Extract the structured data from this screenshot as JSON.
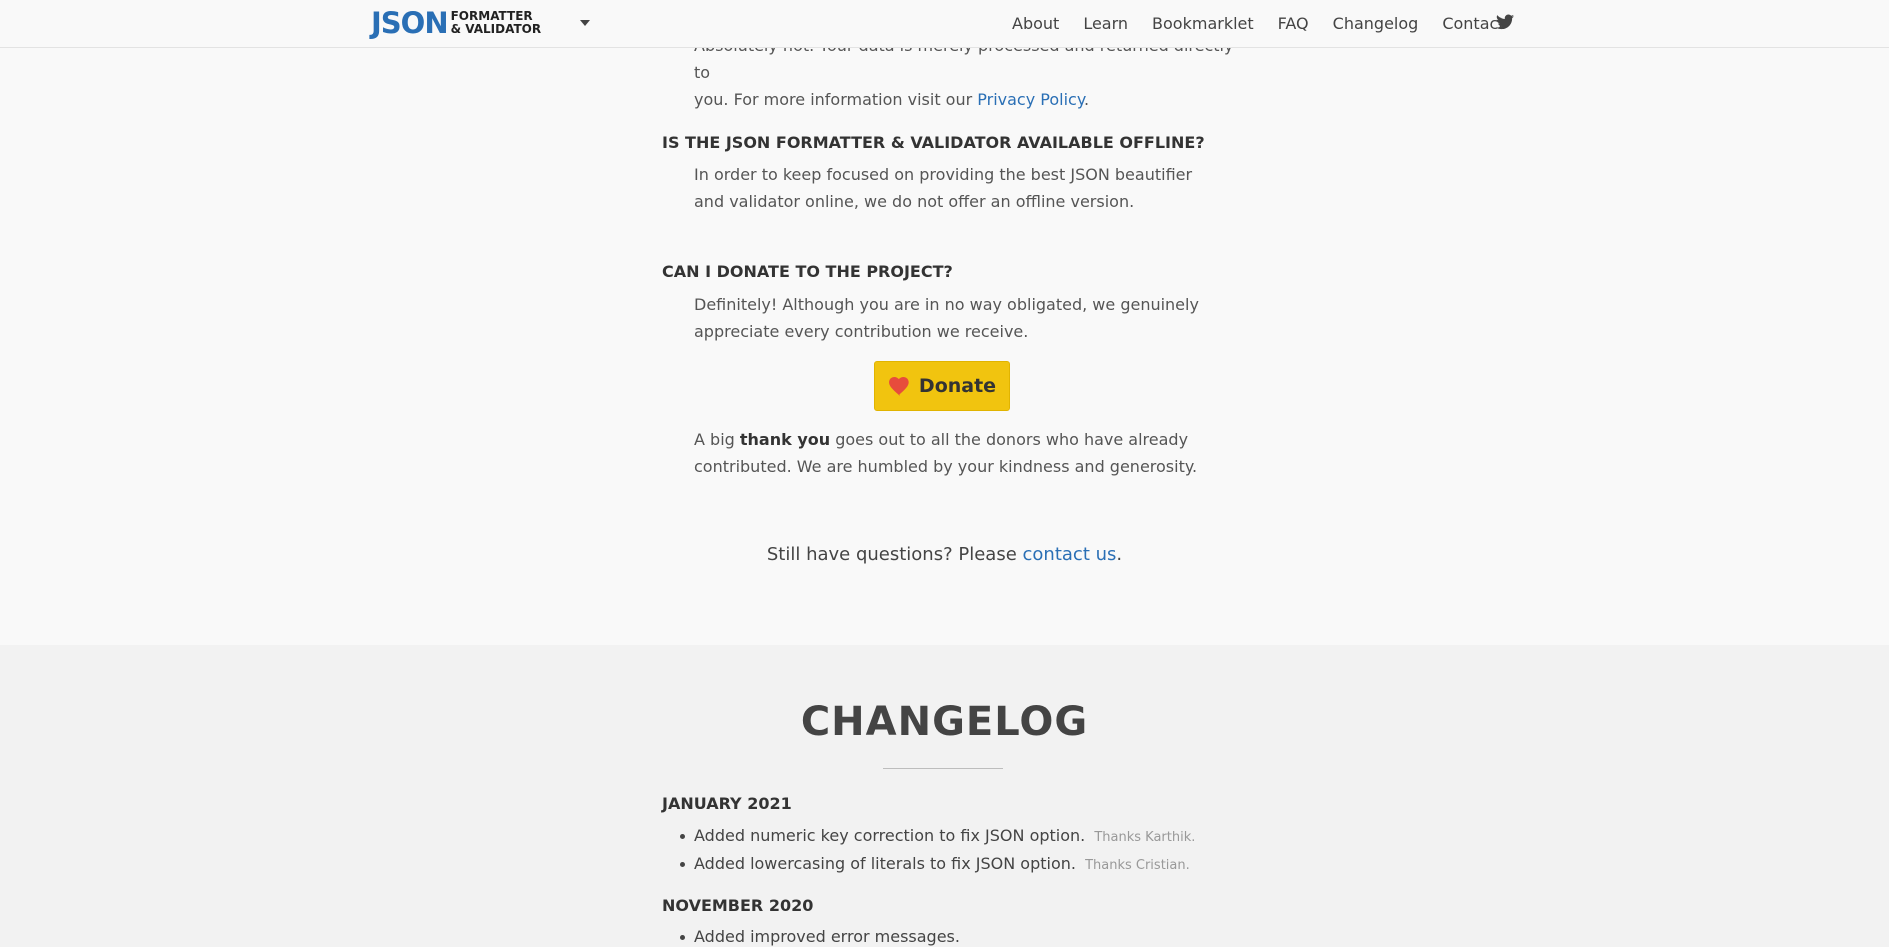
{
  "nav": {
    "logo_main": "JSON",
    "logo_line1": "FORMATTER",
    "logo_line2": "& VALIDATOR",
    "links": [
      "About",
      "Learn",
      "Bookmarklet",
      "FAQ",
      "Changelog",
      "Contact"
    ],
    "twitter_icon": "twitter-icon"
  },
  "faq": {
    "partial_answer_line1": "Absolutely not. Your data is merely processed and returned directly to",
    "partial_answer_line2_prefix": "you. For more information visit our ",
    "privacy_link": "Privacy Policy",
    "partial_answer_line2_suffix": ".",
    "offline_question": "Is the JSON Formatter & Validator available offline?",
    "offline_answer": "In order to keep focused on providing the best JSON beautifier and validator online, we do not offer an offline version.",
    "donate_question": "Can I donate to the project?",
    "donate_answer": "Definitely! Although you are in no way obligated, we genuinely appreciate every contribution we receive.",
    "donate_button": "Donate",
    "thanks_prefix": "A big ",
    "thanks_bold": "thank you",
    "thanks_suffix": " goes out to all the donors who have already contributed. We are humbled by your kindness and generosity.",
    "still_prefix": "Still have questions? Please ",
    "contact_link": "contact us",
    "still_suffix": "."
  },
  "changelog": {
    "title": "CHANGELOG",
    "months": [
      {
        "label": "January 2021",
        "items": [
          {
            "text": "Added numeric key correction to fix JSON option.",
            "thanks": "Thanks Karthik."
          },
          {
            "text": "Added lowercasing of literals to fix JSON option.",
            "thanks": "Thanks Cristian."
          }
        ]
      },
      {
        "label": "November 2020",
        "items": [
          {
            "text": "Added improved error messages.",
            "thanks": ""
          }
        ]
      }
    ]
  },
  "colors": {
    "link": "#2a6fb5",
    "donate_bg": "#f1c40f",
    "heart": "#e74c3c"
  }
}
